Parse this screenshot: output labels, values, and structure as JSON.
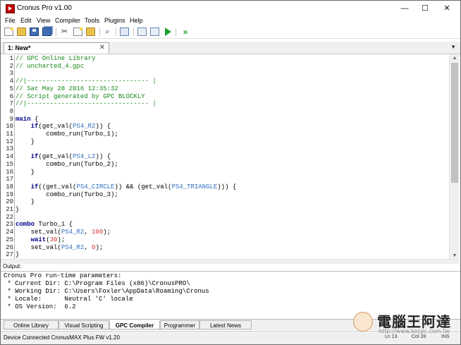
{
  "window": {
    "title": "Cronus Pro v1.00"
  },
  "window_buttons": {
    "minimize": "—",
    "maximize": "☐",
    "close": "✕"
  },
  "menu": [
    "File",
    "Edit",
    "View",
    "Compiler",
    "Tools",
    "Plugins",
    "Help"
  ],
  "toolbar_icons": [
    "new-file-icon",
    "open-folder-icon",
    "save-icon",
    "save-all-icon",
    "cut-icon",
    "copy-icon",
    "paste-icon",
    "find-icon",
    "view-panel-icon",
    "compile-icon",
    "download-icon",
    "run-icon",
    "forward-icon"
  ],
  "tab": {
    "label": "1: New*",
    "close": "✕",
    "menu_arrow": "▼"
  },
  "code": [
    [
      [
        "c",
        "// GPC Online Library"
      ]
    ],
    [
      [
        "c",
        "// uncharted_4.gpc"
      ]
    ],
    [],
    [
      [
        "c",
        "//|-------------------------------- |"
      ]
    ],
    [
      [
        "c",
        "// Sat May 28 2016 12:35:32"
      ]
    ],
    [
      [
        "c",
        "// Script generated by GPC BLOCKLY"
      ]
    ],
    [
      [
        "c",
        "//|-------------------------------- |"
      ]
    ],
    [],
    [
      [
        "k",
        "main"
      ],
      [
        "t",
        " {"
      ]
    ],
    [
      [
        "t",
        "    "
      ],
      [
        "k",
        "if"
      ],
      [
        "t",
        "(get_val("
      ],
      [
        "p",
        "PS4_R2"
      ],
      [
        "t",
        ")) {"
      ]
    ],
    [
      [
        "t",
        "        combo_run(Turbo_1);"
      ]
    ],
    [
      [
        "t",
        "    }"
      ]
    ],
    [],
    [
      [
        "t",
        "    "
      ],
      [
        "k",
        "if"
      ],
      [
        "t",
        "(get_val("
      ],
      [
        "p",
        "PS4_L2"
      ],
      [
        "t",
        ")) {"
      ]
    ],
    [
      [
        "t",
        "        combo_run(Turbo_2);"
      ]
    ],
    [
      [
        "t",
        "    }"
      ]
    ],
    [],
    [
      [
        "t",
        "    "
      ],
      [
        "k",
        "if"
      ],
      [
        "t",
        "((get_val("
      ],
      [
        "p",
        "PS4_CIRCLE"
      ],
      [
        "t",
        ")) && (get_val("
      ],
      [
        "p",
        "PS4_TRIANGLE"
      ],
      [
        "t",
        "))) {"
      ]
    ],
    [
      [
        "t",
        "        combo_run(Turbo_3);"
      ]
    ],
    [
      [
        "t",
        "    }"
      ]
    ],
    [
      [
        "t",
        "}"
      ]
    ],
    [],
    [
      [
        "k",
        "combo"
      ],
      [
        "t",
        " Turbo_1 {"
      ]
    ],
    [
      [
        "t",
        "    set_val("
      ],
      [
        "p",
        "PS4_R2"
      ],
      [
        "t",
        ", "
      ],
      [
        "n",
        "100"
      ],
      [
        "t",
        ");"
      ]
    ],
    [
      [
        "t",
        "    "
      ],
      [
        "k",
        "wait"
      ],
      [
        "t",
        "("
      ],
      [
        "n",
        "30"
      ],
      [
        "t",
        ");"
      ]
    ],
    [
      [
        "t",
        "    set_val("
      ],
      [
        "p",
        "PS4_R2"
      ],
      [
        "t",
        ", "
      ],
      [
        "n",
        "0"
      ],
      [
        "t",
        ");"
      ]
    ],
    [
      [
        "t",
        "}"
      ]
    ]
  ],
  "output": {
    "label": "Output:",
    "lines": [
      "Cronus Pro run-time parameters:",
      " * Current Dir: C:\\Program Files (x86)\\CronusPRO\\",
      " * Working Dir: C:\\Users\\Foxler\\AppData\\Roaming\\Cronus",
      " * Locale:      Neutral 'C' locale",
      " * OS Version:  6.2"
    ]
  },
  "bottom_tabs": [
    "Online Library",
    "Visual Scripting",
    "GPC Compiler",
    "Programmer",
    "Latest News"
  ],
  "active_bottom_tab": "GPC Compiler",
  "status": {
    "device": "Device Connected CronusMAX Plus FW v1.20",
    "line": "Ln 13",
    "col": "Col 28",
    "mode": "INS"
  },
  "watermark": {
    "text": "電腦王阿達",
    "url": "http://www.kocpc.com.tw"
  }
}
